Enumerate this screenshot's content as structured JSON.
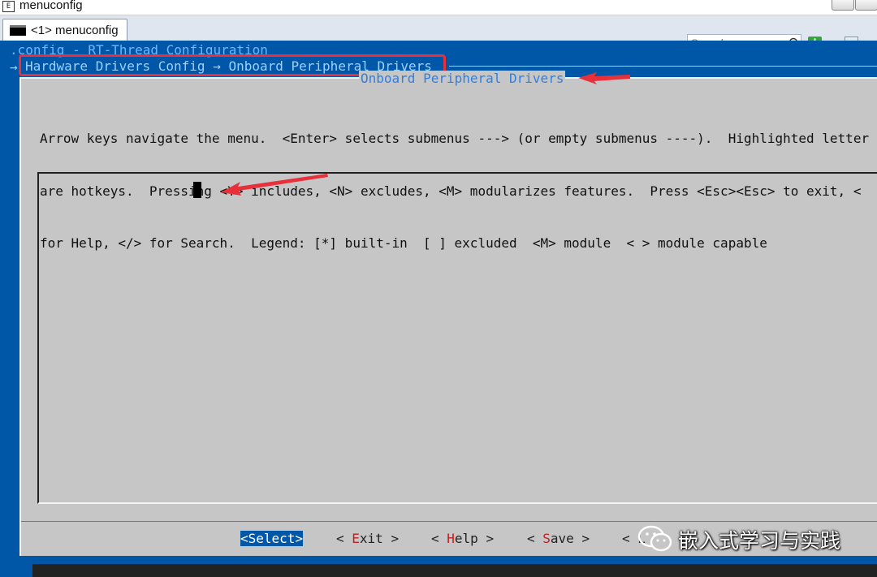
{
  "window": {
    "title": "menuconfig",
    "app_icon_glyph": "E",
    "controls": [
      "minimize-button",
      "maximize-button"
    ]
  },
  "toolbar": {
    "tab_label": "<1> menuconfig",
    "search_placeholder": "Search",
    "add_tab_icon": "plus-icon",
    "add_tab_glyph": "+",
    "view_icon": "view-icon"
  },
  "terminal": {
    "config_line": ".config - RT-Thread Configuration",
    "breadcrumb_arrow": "→",
    "breadcrumb": "Hardware Drivers Config → Onboard Peripheral Drivers",
    "dialog_title": "Onboard Peripheral Drivers",
    "help_lines": [
      "Arrow keys navigate the menu.  <Enter> selects submenus ---> (or empty submenus ----).  Highlighted letter",
      "are hotkeys.  Pressing <Y> includes, <N> excludes, <M> modularizes features.  Press <Esc><Esc> to exit, <",
      "for Help, </> for Search.  Legend: [*] built-in  [ ] excluded  <M> module  < > module capable"
    ],
    "menu_items": [],
    "buttons": {
      "select": "<Select>",
      "exit_prefix": "< ",
      "exit_hotkey": "E",
      "exit_rest": "xit >",
      "help_prefix": "< ",
      "help_hotkey": "H",
      "help_rest": "elp >",
      "save_prefix": "< ",
      "save_hotkey": "S",
      "save_rest": "ave >",
      "load_partial": "< L"
    }
  },
  "watermark": {
    "text": "嵌入式学习与实践",
    "icon": "wechat-icon"
  },
  "colors": {
    "terminal_bg": "#0057a7",
    "dialog_bg": "#c6c6c6",
    "dialog_title": "#2f80e0",
    "hotkey": "#c02020",
    "annotation": "#e8303a"
  }
}
